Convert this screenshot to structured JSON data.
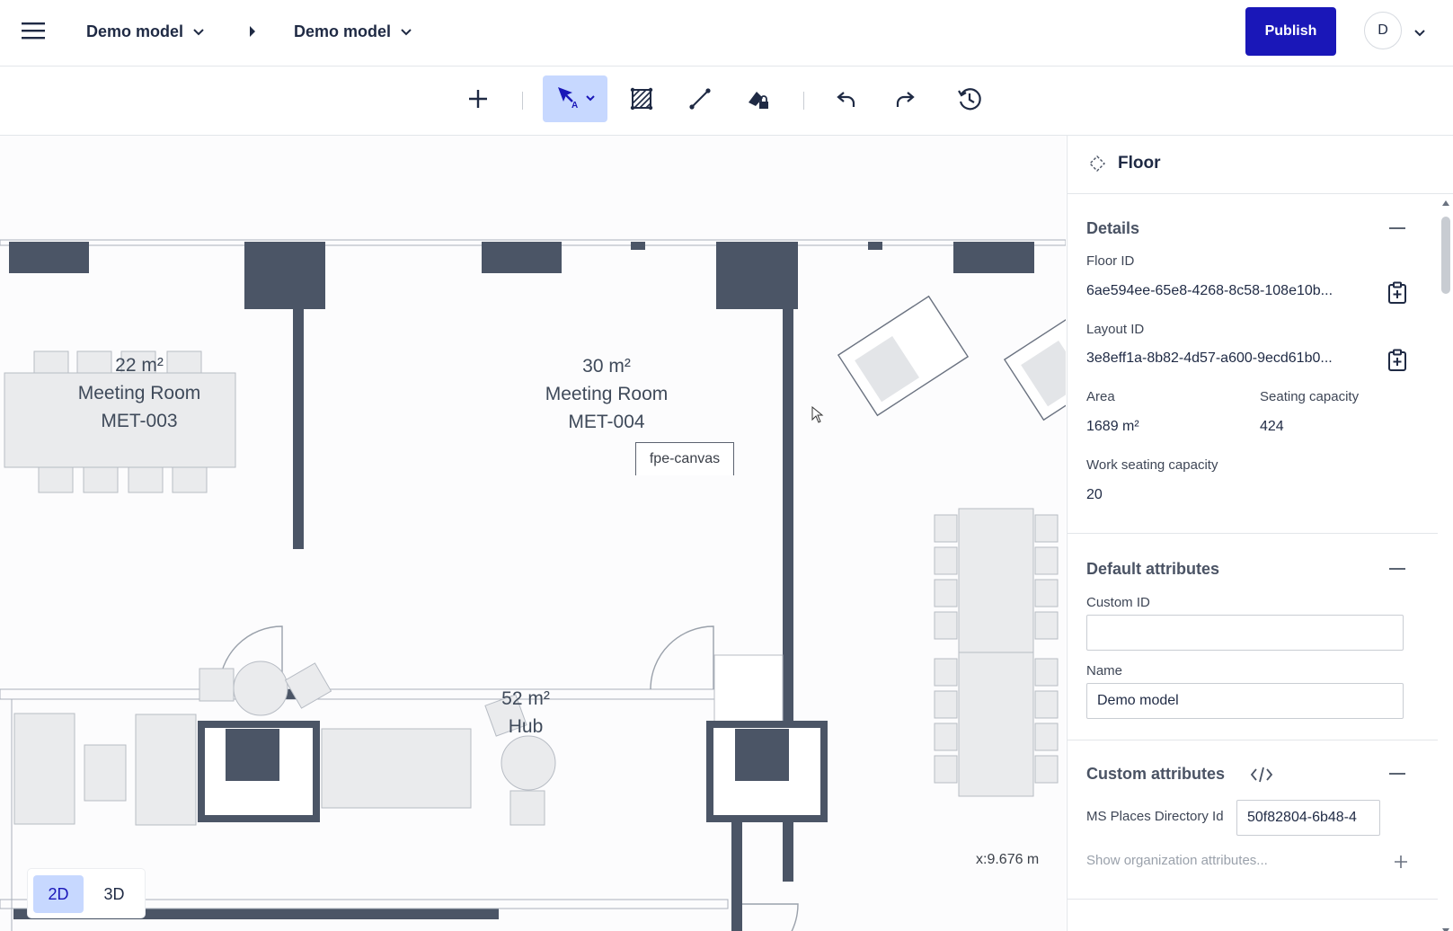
{
  "header": {
    "breadcrumb": [
      {
        "label": "Demo model"
      },
      {
        "label": "Demo model"
      }
    ],
    "publish_label": "Publish",
    "avatar_initial": "D"
  },
  "toolbar": {
    "tools": [
      "add-icon",
      "select-icon",
      "area-hatch-icon",
      "line-icon",
      "lock-fill-icon",
      "undo-icon",
      "redo-icon",
      "history-icon"
    ],
    "active_tool": "select-icon",
    "accent_color": "#1a17b8",
    "active_bg": "#c7d8ff"
  },
  "canvas": {
    "rooms": [
      {
        "area": "22 m²",
        "type": "Meeting Room",
        "code": "MET-003"
      },
      {
        "area": "30 m²",
        "type": "Meeting Room",
        "code": "MET-004"
      },
      {
        "area": "52 m²",
        "type": "Hub"
      }
    ],
    "tooltip": "fpe-canvas",
    "coordinate": "x:9.676 m",
    "view_modes": [
      "2D",
      "3D"
    ],
    "active_view": "2D",
    "wall_color": "#4b5566"
  },
  "panel": {
    "title": "Floor",
    "details": {
      "title": "Details",
      "floor_id_label": "Floor ID",
      "floor_id": "6ae594ee-65e8-4268-8c58-108e10b...",
      "layout_id_label": "Layout ID",
      "layout_id": "3e8eff1a-8b82-4d57-a600-9ecd61b0...",
      "area_label": "Area",
      "area": "1689 m²",
      "seating_label": "Seating capacity",
      "seating": "424",
      "work_seating_label": "Work seating capacity",
      "work_seating": "20"
    },
    "default_attributes": {
      "title": "Default attributes",
      "custom_id_label": "Custom ID",
      "custom_id": "",
      "name_label": "Name",
      "name": "Demo model"
    },
    "custom_attributes": {
      "title": "Custom attributes",
      "ms_places_label": "MS Places Directory Id",
      "ms_places_value": "50f82804-6b48-4",
      "show_org_label": "Show organization attributes..."
    }
  }
}
